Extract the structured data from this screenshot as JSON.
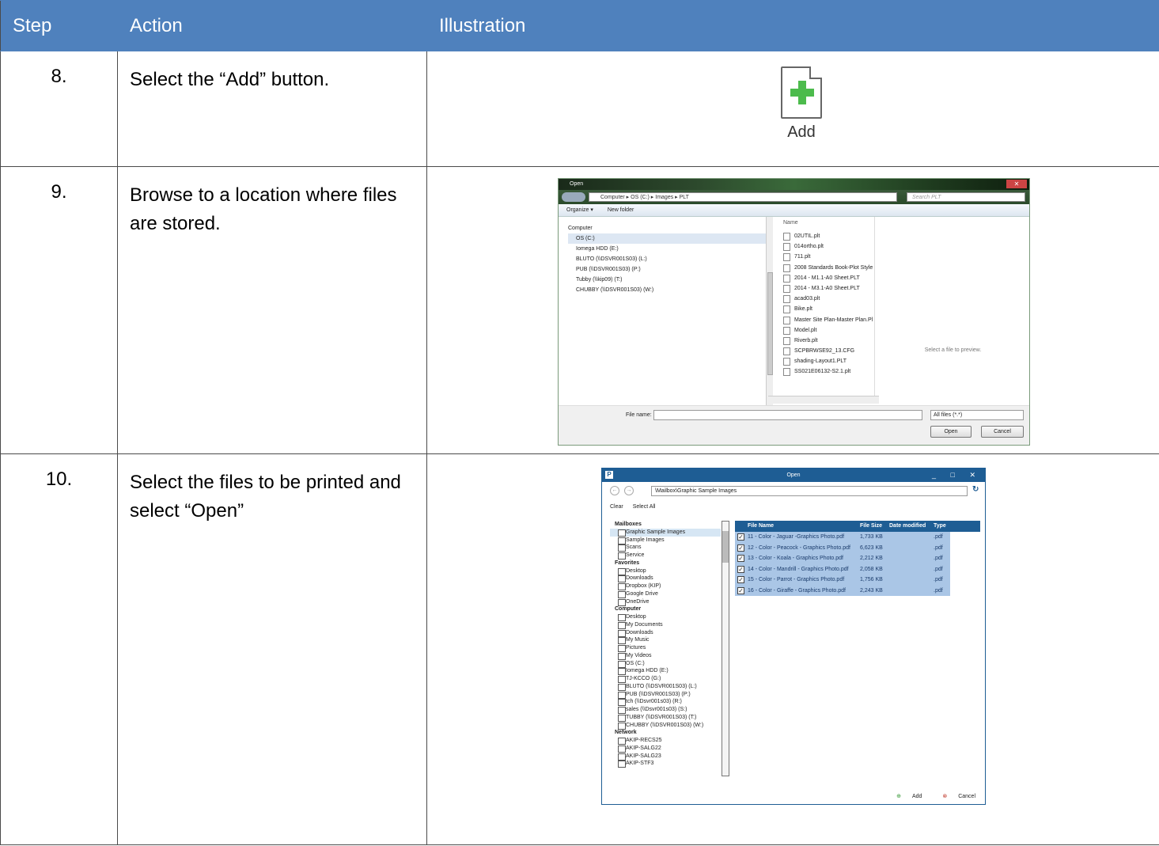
{
  "header": {
    "step": "Step",
    "action": "Action",
    "illustration": "Illustration"
  },
  "rows": [
    {
      "step": "8.",
      "action": "Select the “Add” button.",
      "illustration_label": "Add"
    },
    {
      "step": "9.",
      "action": "Browse to a location where files are stored."
    },
    {
      "step": "10.",
      "action": "Select the files to be printed and select “Open”"
    }
  ],
  "open_dialog": {
    "title": "Open",
    "path": "Computer ▸ OS (C:) ▸ Images ▸ PLT",
    "search_placeholder": "Search PLT",
    "toolbar": [
      "Organize ▾",
      "New folder"
    ],
    "nav_items": [
      "Computer",
      "OS (C:)",
      "Iomega HDD (E:)",
      "BLUTO (\\\\DSVR001S03) (L:)",
      "PUB (\\\\DSVR001S03) (P:)",
      "Tubby (\\\\kip09) (T:)",
      "CHUBBY (\\\\DSVR001S03) (W:)"
    ],
    "column_name": "Name",
    "files": [
      "02UTIL.plt",
      "014ortho.plt",
      "711.plt",
      "2008 Standards Book-Plot Style",
      "2014 - M1.1-A0 Sheet.PLT",
      "2014 - M3.1-A0 Sheet.PLT",
      "acad03.plt",
      "Bike.plt",
      "Master Site Plan-Master Plan.Pl",
      "Model.plt",
      "Riverb.plt",
      "SCPBRWSE92_13.CFG",
      "shading-Layout1.PLT",
      "SS021E06132-S2.1.plt"
    ],
    "preview_text": "Select a file to preview.",
    "file_name_label": "File name:",
    "file_type": "All files (*.*)",
    "open_button": "Open",
    "cancel_button": "Cancel"
  },
  "kip_dialog": {
    "title": "Open",
    "path": "\\Mailbox\\Graphic Sample Images",
    "clear": "Clear",
    "select_all": "Select All",
    "tree": [
      {
        "label": "Mailboxes",
        "header": true
      },
      {
        "label": "Graphic Sample Images",
        "selected": true
      },
      {
        "label": "Sample Images"
      },
      {
        "label": "Scans"
      },
      {
        "label": "Service"
      },
      {
        "label": "Favorites",
        "header": true
      },
      {
        "label": "Desktop"
      },
      {
        "label": "Downloads"
      },
      {
        "label": "Dropbox (KIP)"
      },
      {
        "label": "Google Drive"
      },
      {
        "label": "OneDrive"
      },
      {
        "label": "Computer",
        "header": true
      },
      {
        "label": "Desktop"
      },
      {
        "label": "My Documents"
      },
      {
        "label": "Downloads"
      },
      {
        "label": "My Music"
      },
      {
        "label": "Pictures"
      },
      {
        "label": "My Videos"
      },
      {
        "label": "OS (C:)"
      },
      {
        "label": "Iomega HDD (E:)"
      },
      {
        "label": "TJ-KCCO (G:)"
      },
      {
        "label": "BLUTO (\\\\DSVR001S03) (L:)"
      },
      {
        "label": "PUB (\\\\DSVR001S03) (P:)"
      },
      {
        "label": "tch (\\\\Dsvr001s03) (R:)"
      },
      {
        "label": "sales (\\\\Dsvr001s03) (S:)"
      },
      {
        "label": "TUBBY (\\\\DSVR001S03) (T:)"
      },
      {
        "label": "CHUBBY (\\\\DSVR001S03) (W:)"
      },
      {
        "label": "Network",
        "header": true
      },
      {
        "label": "AKIP-RECS25"
      },
      {
        "label": "AKIP-SALG22"
      },
      {
        "label": "AKIP-SALG23"
      },
      {
        "label": "AKIP-STF3"
      }
    ],
    "columns": [
      "File Name",
      "File Size",
      "Date modified",
      "Type"
    ],
    "files": [
      {
        "name": "11 - Color - Jaguar -Graphics Photo.pdf",
        "size": "1,733 KB",
        "type": ".pdf"
      },
      {
        "name": "12 - Color - Peacock - Graphics Photo.pdf",
        "size": "6,623 KB",
        "type": ".pdf"
      },
      {
        "name": "13 - Color - Koala - Graphics Photo.pdf",
        "size": "2,212 KB",
        "type": ".pdf"
      },
      {
        "name": "14 - Color - Mandrill - Graphics Photo.pdf",
        "size": "2,058 KB",
        "type": ".pdf"
      },
      {
        "name": "15 - Color - Parrot - Graphics Photo.pdf",
        "size": "1,756 KB",
        "type": ".pdf"
      },
      {
        "name": "16 - Color - Giraffe - Graphics Photo.pdf",
        "size": "2,243 KB",
        "type": ".pdf"
      }
    ],
    "add_button": "Add",
    "cancel_button": "Cancel"
  },
  "colors": {
    "header_bg": "#4f81bd",
    "kip_blue": "#1e5d94",
    "selection": "#aac6e6",
    "plus_green": "#4cbb4c"
  }
}
